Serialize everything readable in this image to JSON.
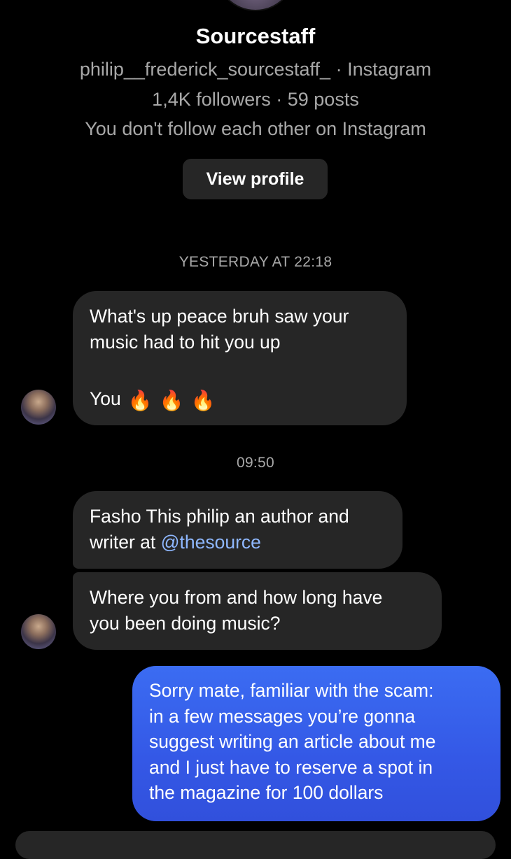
{
  "profile": {
    "name": "Sourcestaff",
    "handle_line": "philip__frederick_sourcestaff_ · Instagram",
    "stats_line": "1,4K followers · 59 posts",
    "follow_line": "You don't follow each other on Instagram",
    "view_profile_label": "View profile"
  },
  "thread": {
    "timestamp_1": "YESTERDAY AT 22:18",
    "timestamp_2": "09:50",
    "msg1": {
      "line1": "What's up peace bruh saw your",
      "line2": "music had to hit you up",
      "line3": "You"
    },
    "msg2": {
      "line1": "Fasho This philip an author and",
      "line2_prefix": "writer at ",
      "line2_mention": "@thesource"
    },
    "msg3": {
      "line1": "Where you from and how long have",
      "line2": "you been doing music?"
    },
    "msg4": {
      "line1": "Sorry mate, familiar with the scam:",
      "line2": "in a few messages you’re gonna",
      "line3": "suggest writing an article about me",
      "line4": "and I just have to reserve a spot in",
      "line5": "the magazine for 100 dollars"
    }
  },
  "icons": {
    "fire": "🔥"
  },
  "colors": {
    "background": "#000000",
    "incoming_bubble": "#262626",
    "outgoing_bubble": "#3458e6",
    "secondary_text": "#a8a8a8",
    "mention": "#8fb8ff"
  }
}
